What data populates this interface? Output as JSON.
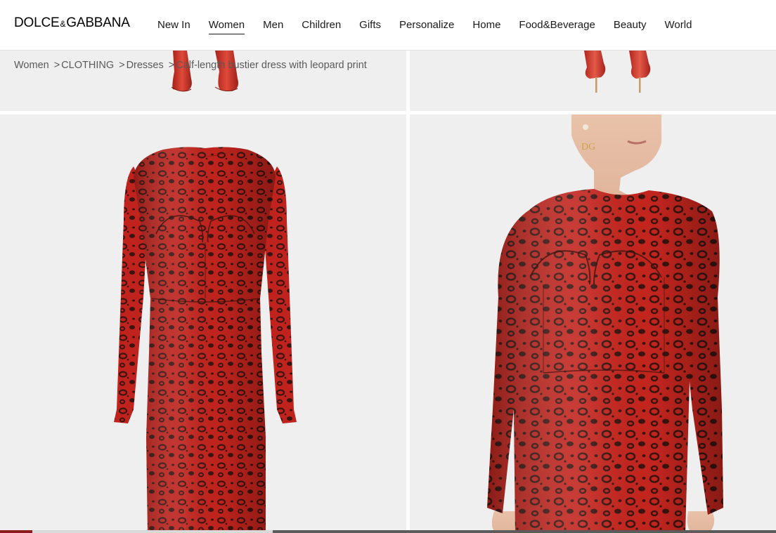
{
  "brand": {
    "name_part1": "DOLCE",
    "amp": "&",
    "name_part2": "GABBANA"
  },
  "nav": {
    "items": [
      {
        "label": "New In",
        "active": false
      },
      {
        "label": "Women",
        "active": true
      },
      {
        "label": "Men",
        "active": false
      },
      {
        "label": "Children",
        "active": false
      },
      {
        "label": "Gifts",
        "active": false
      },
      {
        "label": "Personalize",
        "active": false
      },
      {
        "label": "Home",
        "active": false
      },
      {
        "label": "Food&Beverage",
        "active": false
      },
      {
        "label": "Beauty",
        "active": false
      },
      {
        "label": "World",
        "active": false
      }
    ]
  },
  "breadcrumb": {
    "items": [
      "Women",
      "CLOTHING",
      "Dresses",
      "Calf-length bustier dress with leopard print"
    ],
    "separator": ">"
  },
  "gallery": {
    "images": [
      {
        "label": "red-pumps-image"
      },
      {
        "label": "red-pumps-side-image"
      },
      {
        "label": "leopard-dress-front-image"
      },
      {
        "label": "leopard-dress-model-image"
      }
    ]
  },
  "colors": {
    "leopard_red": "#c0231d",
    "leopard_spot": "#3a1410",
    "tile_bg": "#efefef",
    "scroll_accent": "#8a1c1c"
  }
}
